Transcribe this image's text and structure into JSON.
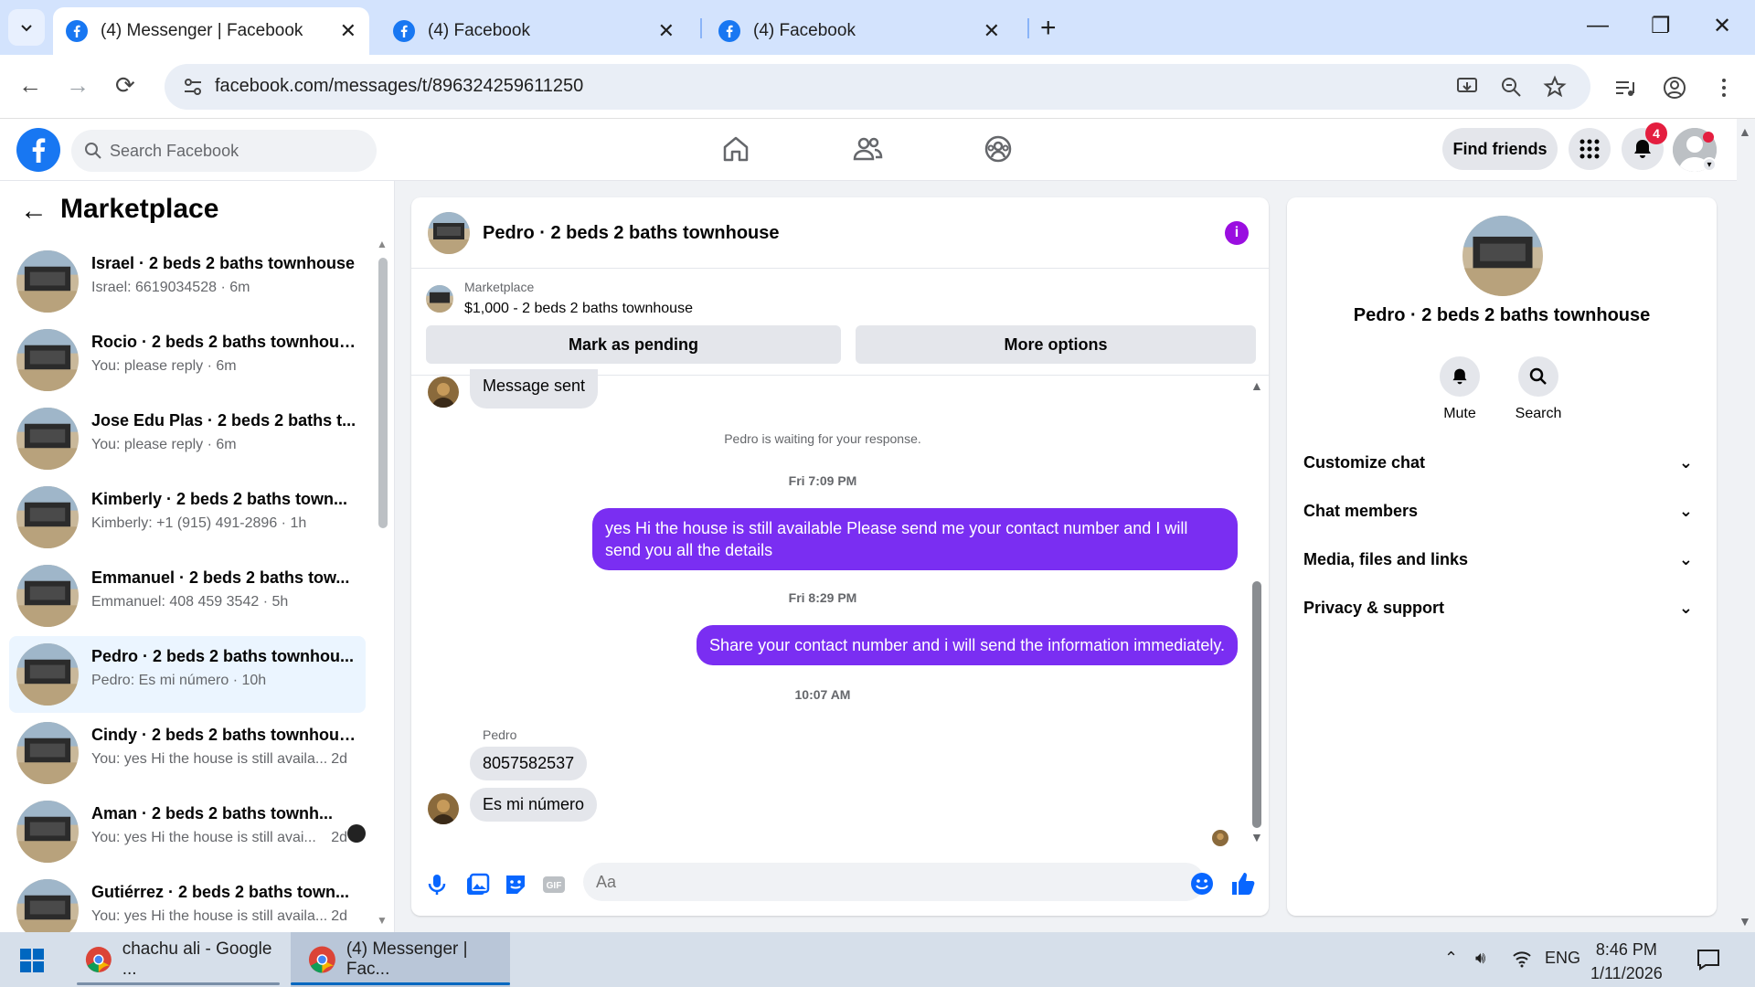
{
  "browser": {
    "tabs": [
      {
        "title": "(4) Messenger | Facebook",
        "active": true
      },
      {
        "title": "(4) Facebook",
        "active": false
      },
      {
        "title": "(4) Facebook",
        "active": false
      }
    ],
    "url": "facebook.com/messages/t/896324259611250"
  },
  "header": {
    "search_placeholder": "Search Facebook",
    "find_friends": "Find friends",
    "notification_count": "4"
  },
  "sidebar": {
    "title": "Marketplace",
    "conversations": [
      {
        "name": "Israel · 2 beds 2 baths townhouse",
        "preview": "Israel: 6619034528 · 6m",
        "time": ""
      },
      {
        "name": "Rocio · 2 beds 2 baths townhouse",
        "preview": "You: please reply · 6m",
        "time": ""
      },
      {
        "name": "Jose Edu Plas · 2 beds 2 baths t...",
        "preview": "You: please reply · 6m",
        "time": ""
      },
      {
        "name": "Kimberly · 2 beds 2 baths town...",
        "preview": "Kimberly: +1 (915) 491-2896 · 1h",
        "time": ""
      },
      {
        "name": "Emmanuel · 2 beds 2 baths tow...",
        "preview": "Emmanuel: 408 459 3542 · 5h",
        "time": ""
      },
      {
        "name": "Pedro · 2 beds 2 baths townhou...",
        "preview": "Pedro: Es mi número · 10h",
        "time": ""
      },
      {
        "name": "Cindy · 2 beds 2 baths townhouse",
        "preview": "You: yes Hi the house is still availa...",
        "time": "2d"
      },
      {
        "name": "Aman · 2 beds 2 baths townh...",
        "preview": "You: yes Hi the house is still avai...",
        "time": "2d"
      },
      {
        "name": "Gutiérrez · 2 beds 2 baths town...",
        "preview": "You: yes Hi the house is still availa...",
        "time": "2d"
      }
    ]
  },
  "chat": {
    "title": "Pedro · 2 beds 2 baths townhouse",
    "marketplace_label": "Marketplace",
    "listing": "$1,000 - 2 beds 2 baths townhouse",
    "mark_pending": "Mark as pending",
    "more_options": "More options",
    "msg_sent": "Message sent",
    "waiting": "Pedro is waiting for your response.",
    "ts1": "Fri 7:09 PM",
    "out1": "yes Hi the house is still available Please send me your contact number and I will send you all the details",
    "ts2": "Fri 8:29 PM",
    "out2": "Share your contact number and i will send the information immediately.",
    "ts3": "10:07 AM",
    "sender": "Pedro",
    "in1": "8057582537",
    "in2": "Es mi número",
    "composer_placeholder": "Aa"
  },
  "info": {
    "name": "Pedro · 2 beds 2 baths townhouse",
    "mute": "Mute",
    "search": "Search",
    "sections": [
      "Customize chat",
      "Chat members",
      "Media, files and links",
      "Privacy & support"
    ]
  },
  "taskbar": {
    "task1": "chachu ali - Google ...",
    "task2": "(4) Messenger | Fac...",
    "lang": "ENG",
    "time": "8:46 PM",
    "date": "1/11/2026"
  }
}
